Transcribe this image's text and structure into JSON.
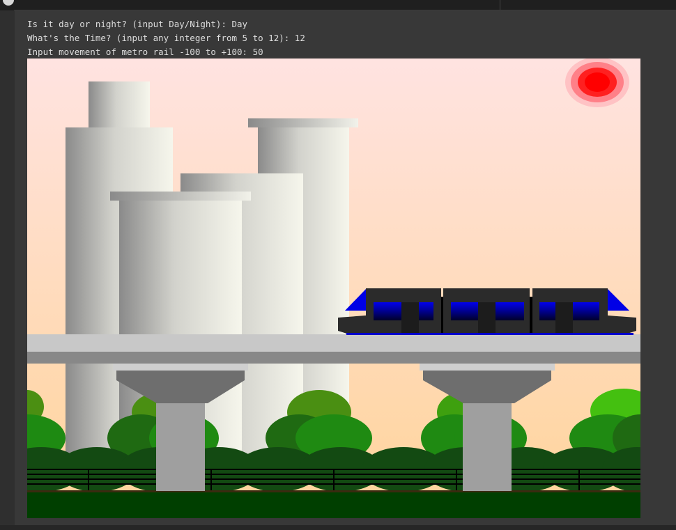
{
  "console": {
    "lines": [
      "Is it day or night? (input Day/Night): Day",
      "What's the Time? (input any integer from 5 to 12): 12",
      "Input movement of metro rail -100 to +100: 50"
    ]
  },
  "scene": {
    "day_or_night": "Day",
    "time": 12,
    "metro_movement": 50,
    "colors": {
      "sky_top": "#ffe3e1",
      "sky_bottom": "#ffd49a",
      "sun": "#ff0000",
      "train_window": "#0000cc",
      "train_body": "#2b2b2b",
      "track": "#c8c8c8",
      "pillar": "#9f9f9f",
      "ground": "#003f00"
    }
  }
}
